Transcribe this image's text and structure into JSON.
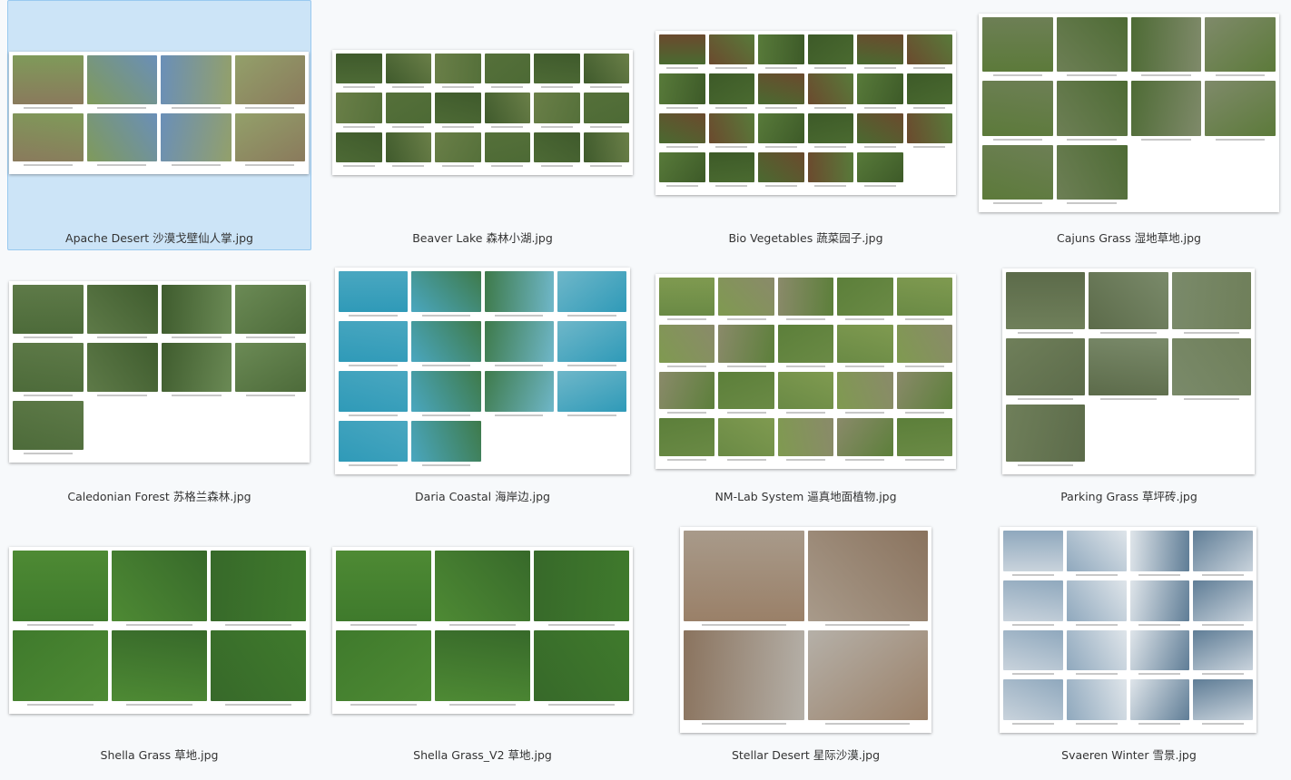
{
  "files": [
    {
      "name": "Apache Desert 沙漠戈壁仙人掌.jpg",
      "selected": true,
      "cols": 4,
      "tiles": 8,
      "colors": [
        "#8a7a5c",
        "#7f9a5a",
        "#6a8fb8",
        "#93a06a"
      ]
    },
    {
      "name": "Beaver Lake 森林小湖.jpg",
      "cols": 6,
      "tiles": 18,
      "colors": [
        "#4d6a35",
        "#3f5a2c",
        "#6a7f48",
        "#55703a"
      ]
    },
    {
      "name": "Bio Vegetables 蔬菜园子.jpg",
      "cols": 6,
      "tiles": 23,
      "colors": [
        "#4a6a30",
        "#6b4a2e",
        "#587a3a",
        "#3d5a28"
      ]
    },
    {
      "name": "Cajuns Grass 湿地草地.jpg",
      "cols": 4,
      "tiles": 10,
      "colors": [
        "#5c7a3a",
        "#6d7f55",
        "#4e6b35",
        "#7f8a6a"
      ]
    },
    {
      "name": "Caledonian Forest 苏格兰森林.jpg",
      "cols": 4,
      "tiles": 9,
      "colors": [
        "#4d6b3a",
        "#5e7a48",
        "#3f5c2e",
        "#6b8a55"
      ]
    },
    {
      "name": "Daria Coastal 海岸边.jpg",
      "cols": 4,
      "tiles": 14,
      "colors": [
        "#2f9ab8",
        "#4aa7c0",
        "#3e7a4a",
        "#6fb7c9"
      ]
    },
    {
      "name": "NM-Lab System 逼真地面植物.jpg",
      "cols": 5,
      "tiles": 20,
      "colors": [
        "#6a8a45",
        "#7f9a50",
        "#8a8a6a",
        "#5c7f3a"
      ]
    },
    {
      "name": "Parking Grass 草坪砖.jpg",
      "cols": 3,
      "tiles": 7,
      "colors": [
        "#6f7f5a",
        "#5c6b4a",
        "#7a8a6a"
      ]
    },
    {
      "name": "Shella Grass 草地.jpg",
      "cols": 3,
      "tiles": 6,
      "colors": [
        "#3f7a2c",
        "#4e8a34",
        "#37692a"
      ]
    },
    {
      "name": "Shella Grass_V2 草地.jpg",
      "cols": 3,
      "tiles": 6,
      "colors": [
        "#3f7a2c",
        "#4e8a34",
        "#37692a"
      ]
    },
    {
      "name": "Stellar Desert 星际沙漠.jpg",
      "cols": 2,
      "tiles": 4,
      "colors": [
        "#9a8068",
        "#a89a8a",
        "#8a735e",
        "#b5b0a8"
      ]
    },
    {
      "name": "Svaeren Winter 雪景.jpg",
      "cols": 4,
      "tiles": 16,
      "colors": [
        "#c9d3dc",
        "#8fa8bd",
        "#dfe5ea",
        "#5f7d96"
      ]
    }
  ]
}
